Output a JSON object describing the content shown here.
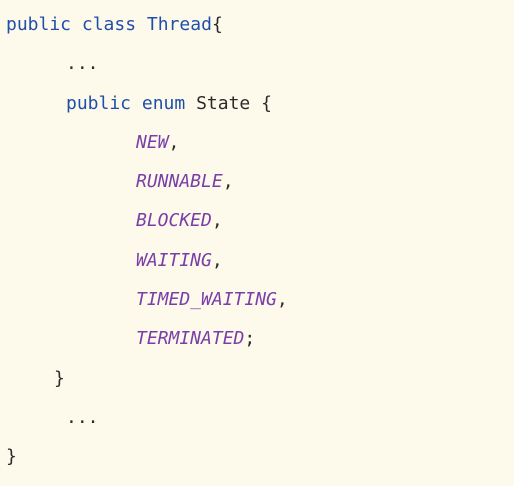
{
  "code": {
    "line1": {
      "kw1": "public",
      "kw2": "class",
      "name": "Thread",
      "brace": "{"
    },
    "line2": {
      "text": "..."
    },
    "line3": {
      "kw1": "public",
      "kw2": "enum",
      "name": "State",
      "brace": "{"
    },
    "constants": [
      {
        "name": "NEW",
        "punct": ","
      },
      {
        "name": "RUNNABLE",
        "punct": ","
      },
      {
        "name": "BLOCKED",
        "punct": ","
      },
      {
        "name": "WAITING",
        "punct": ","
      },
      {
        "name": "TIMED_WAITING",
        "punct": ","
      },
      {
        "name": "TERMINATED",
        "punct": ";"
      }
    ],
    "line10": {
      "text": "}"
    },
    "line11": {
      "text": "..."
    },
    "line12": {
      "text": "}"
    }
  },
  "colors": {
    "background": "#fdfaeb",
    "keyword": "#1f4fa8",
    "constant": "#7a3ea8",
    "text": "#2b2b2b"
  }
}
